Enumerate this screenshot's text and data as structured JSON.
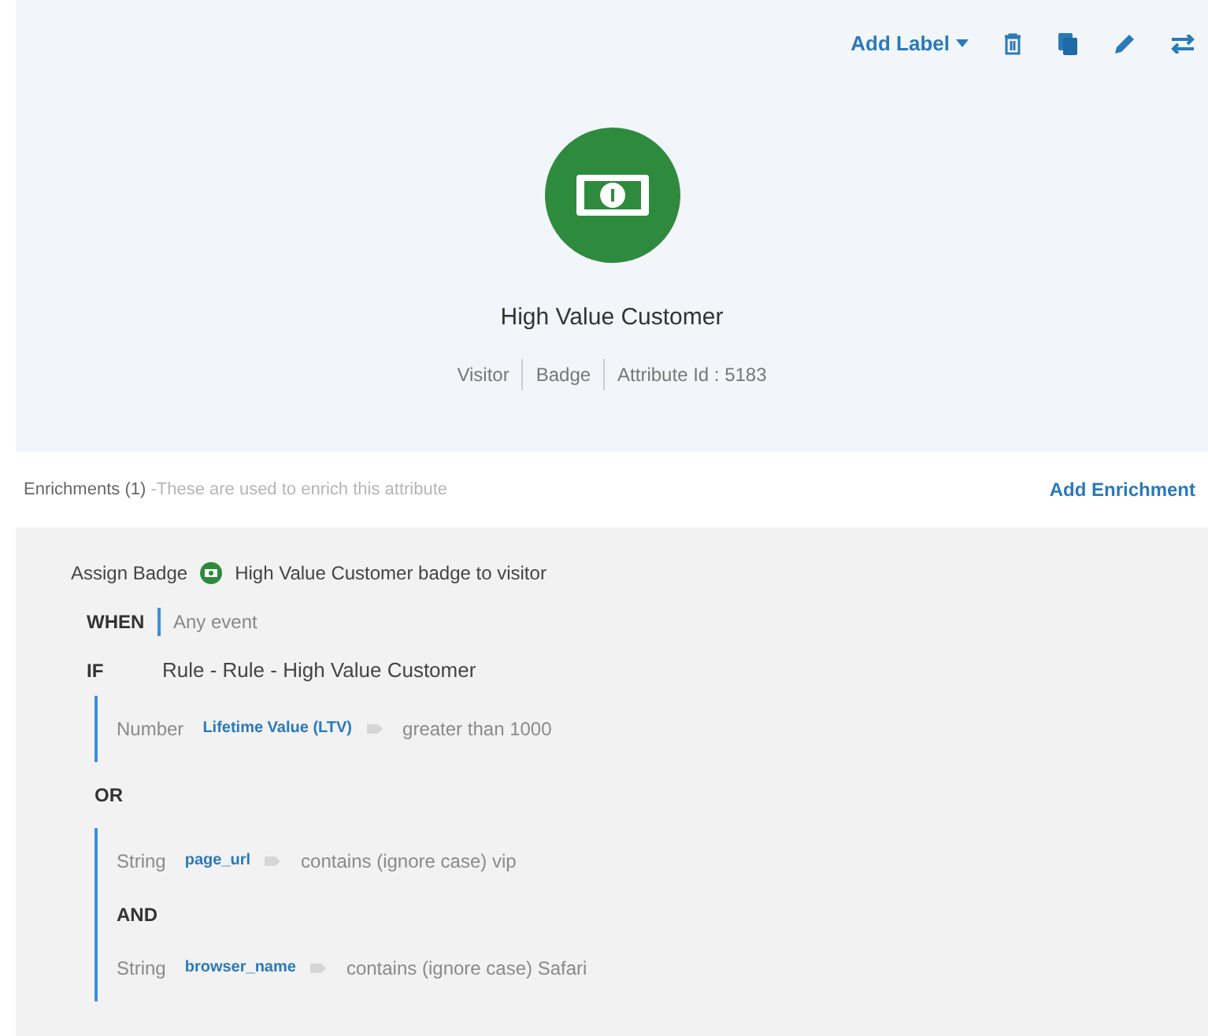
{
  "toolbar": {
    "add_label": "Add Label"
  },
  "attribute": {
    "title": "High Value Customer",
    "meta": [
      "Visitor",
      "Badge",
      "Attribute Id : 5183"
    ]
  },
  "enrichments": {
    "heading": "Enrichments (1)",
    "hint": "-These are used to enrich this attribute",
    "add_button": "Add Enrichment"
  },
  "enrichment": {
    "action": "Assign Badge",
    "badge_text": "High Value Customer badge to visitor",
    "when_label": "WHEN",
    "when_value": "Any event",
    "if_label": "IF",
    "rule": "Rule - Rule - High Value Customer",
    "blocks": [
      {
        "kind": "group",
        "items": [
          {
            "kind": "condition",
            "type": "Number",
            "field": "Lifetime Value (LTV)",
            "operator": "greater than 1000"
          }
        ]
      },
      {
        "kind": "connector",
        "label": "OR"
      },
      {
        "kind": "group",
        "items": [
          {
            "kind": "condition",
            "type": "String",
            "field": "page_url",
            "operator": "contains (ignore case) vip"
          },
          {
            "kind": "connector",
            "label": "AND"
          },
          {
            "kind": "condition",
            "type": "String",
            "field": "browser_name",
            "operator": "contains (ignore case) Safari"
          }
        ]
      }
    ]
  }
}
